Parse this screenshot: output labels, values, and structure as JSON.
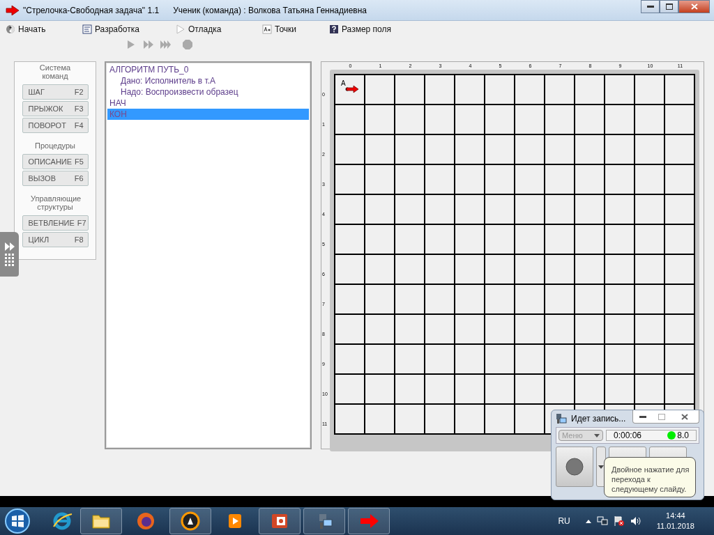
{
  "window": {
    "title": "\"Стрелочка-Свободная задача\" 1.1",
    "student": "Ученик (команда) : Волкова Татьяна Геннадиевна"
  },
  "menu": [
    {
      "label": "Начать"
    },
    {
      "label": "Разработка"
    },
    {
      "label": "Отладка"
    },
    {
      "label": "Точки"
    },
    {
      "label": "Размер поля"
    }
  ],
  "toolbar": [
    {
      "disabled": true
    },
    {
      "disabled": true
    },
    {
      "disabled": true
    },
    {
      "disabled": true
    }
  ],
  "commands": [
    {
      "title": "Система команд",
      "buttons": [
        {
          "label": "ШАГ",
          "key": "F2"
        },
        {
          "label": "ПРЫЖОК",
          "key": "F3"
        },
        {
          "label": "ПОВОРОТ",
          "key": "F4"
        }
      ]
    },
    {
      "title": "Процедуры",
      "buttons": [
        {
          "label": "ОПИСАНИЕ",
          "key": "F5"
        },
        {
          "label": "ВЫЗОВ",
          "key": "F6"
        }
      ]
    },
    {
      "title": "Управляющие структуры",
      "buttons": [
        {
          "label": "ВЕТВЛЕНИЕ",
          "key": "F7"
        },
        {
          "label": "ЦИКЛ",
          "key": "F8"
        }
      ]
    }
  ],
  "code": [
    {
      "text": "АЛГОРИТМ ПУТЬ_0",
      "selected": false,
      "children": [
        {
          "text": "Дано: Исполнитель в т.А",
          "selected": false
        },
        {
          "text": "Надо: Воспроизвести образец",
          "selected": false
        }
      ]
    },
    {
      "text": "НАЧ",
      "selected": false
    },
    {
      "text": "КОН",
      "selected": true
    }
  ],
  "field": {
    "columns": [
      "0",
      "1",
      "2",
      "3",
      "4",
      "5",
      "6",
      "7",
      "8",
      "9",
      "10",
      "11"
    ],
    "rows": [
      "0",
      "1",
      "2",
      "3",
      "4",
      "5",
      "6",
      "7",
      "8",
      "9",
      "10",
      "11"
    ],
    "marker": {
      "label": "A"
    }
  },
  "recorder": {
    "title": "Идет запись...",
    "menu": {
      "label": "Меню",
      "disabled": true
    },
    "time": "0:00:06",
    "value": "8.0",
    "tooltip": "Двойное нажатие для перехода к следующему слайду."
  },
  "taskbar": {
    "language": "RU",
    "time": "14:44",
    "date": "11.01.2018"
  }
}
